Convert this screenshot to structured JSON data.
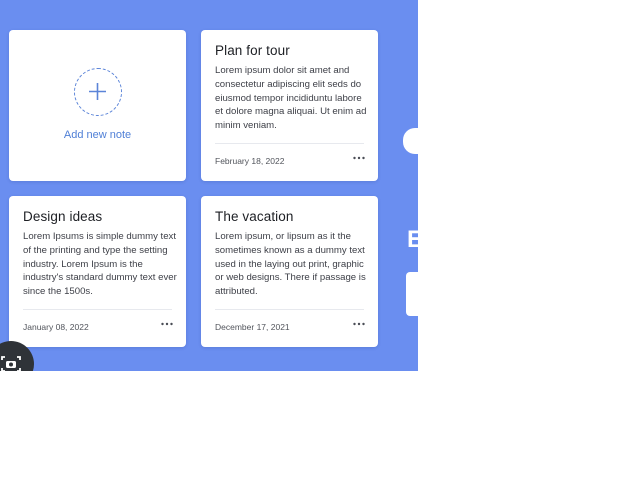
{
  "add_note": {
    "label": "Add new note",
    "icon": "plus-icon"
  },
  "notes": [
    {
      "title": "Plan for tour",
      "body": "Lorem ipsum dolor sit amet and consectetur adipiscing elit seds do eiusmod tempor incididuntu labore et dolore magna aliquai. Ut enim ad minim veniam.",
      "date": "February 18, 2022",
      "menu_icon": "more-horizontal-icon"
    },
    {
      "title": "Design ideas",
      "body": "Lorem Ipsums is simple dummy text of the printing and type the setting industry. Lorem Ipsum is the industry's standard dummy text ever since the 1500s.",
      "date": "January 08, 2022",
      "menu_icon": "more-horizontal-icon"
    },
    {
      "title": "The vacation",
      "body": "Lorem ipsum, or lipsum as it the sometimes known as a dummy text used in the laying out print, graphic or web designs. There if passage is attributed.",
      "date": "December 17, 2021",
      "menu_icon": "more-horizontal-icon"
    }
  ],
  "edge": {
    "partial_text": "E"
  },
  "overlay": {
    "icon": "camera-icon"
  },
  "colors": {
    "background": "#6a8ef0",
    "card": "#ffffff",
    "accent": "#4f7fd6",
    "title": "#1d1f24",
    "body": "#3e4048"
  }
}
